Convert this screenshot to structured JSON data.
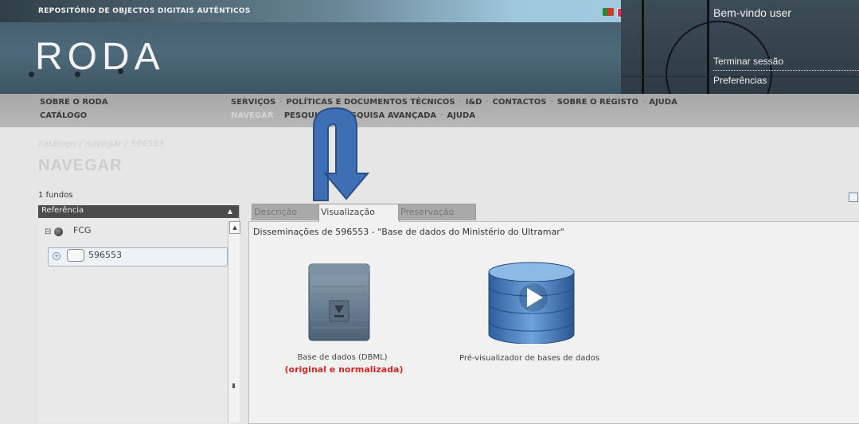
{
  "header": {
    "repository": "REPOSITÓRIO DE OBJECTOS DIGITAIS AUTÊNTICOS",
    "logo": "RODA",
    "welcome": "Bem-vindo user",
    "logout": "Terminar sessão",
    "preferences": "Preferências"
  },
  "nav": {
    "sobre": "SOBRE O RODA",
    "catalogo": "CATÁLOGO",
    "row1": [
      "SERVIÇOS",
      "POLÍTICAS E DOCUMENTOS TÉCNICOS",
      "I&D",
      "CONTACTOS",
      "SOBRE O REGISTO",
      "AJUDA"
    ],
    "row2": [
      "NAVEGAR",
      "PESQUISA",
      "PESQUISA AVANÇADA",
      "AJUDA"
    ]
  },
  "breadcrumb": {
    "catalogo": "catálogo",
    "navegar": "navegar",
    "current": "596553",
    "separator": "/"
  },
  "page_title": "NAVEGAR",
  "tree": {
    "count": "1 fundos",
    "column": "Referência",
    "root": "FCG",
    "child": "596553"
  },
  "tabs": {
    "descricao": "Descrição",
    "visualizacao": "Visualização",
    "preservacao": "Preservação"
  },
  "content": {
    "heading": "Disseminações de 596553 - \"Base de dados do Ministério do Ultramar\"",
    "item1": {
      "label": "Base de dados (DBML)",
      "note": "(original e normalizada)"
    },
    "item2": {
      "label": "Pré-visualizador de bases de dados"
    }
  },
  "colors": {
    "accent_red": "#cc2a2a",
    "arrow_blue": "#3e6fb4",
    "header_bg": "#4e6a7a"
  }
}
